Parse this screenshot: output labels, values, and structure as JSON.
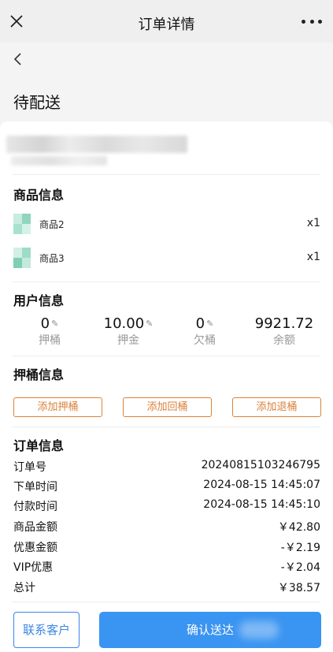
{
  "topbar": {
    "title": "订单详情"
  },
  "status": "待配送",
  "goods": {
    "title": "商品信息",
    "items": [
      {
        "name": "商品2",
        "qty": "x1"
      },
      {
        "name": "商品3",
        "qty": "x1"
      }
    ]
  },
  "user": {
    "title": "用户信息",
    "stats": [
      {
        "value": "0",
        "label": "押桶",
        "editable": true
      },
      {
        "value": "10.00",
        "label": "押金",
        "editable": true
      },
      {
        "value": "0",
        "label": "欠桶",
        "editable": true
      },
      {
        "value": "9921.72",
        "label": "余额",
        "editable": false
      }
    ]
  },
  "bucket": {
    "title": "押桶信息",
    "buttons": [
      "添加押桶",
      "添加回桶",
      "添加退桶"
    ]
  },
  "order": {
    "title": "订单信息",
    "rows": [
      {
        "key": "订单号",
        "value": "20240815103246795"
      },
      {
        "key": "下单时间",
        "value": "2024-08-15 14:45:07"
      },
      {
        "key": "付款时间",
        "value": "2024-08-15 14:45:10"
      },
      {
        "key": "商品金额",
        "value": "￥42.80"
      },
      {
        "key": "优惠金额",
        "value": "-￥2.19"
      },
      {
        "key": "VIP优惠",
        "value": "-￥2.04"
      },
      {
        "key": "总计",
        "value": "￥38.57"
      }
    ]
  },
  "actions": {
    "contact": "联系客户",
    "confirm": "确认送达"
  },
  "colors": {
    "accent_orange": "#d9823b",
    "primary_blue": "#3a94f1",
    "thumb_green": "#9fdcc6"
  },
  "icons": {
    "close": "close-icon",
    "more": "more-icon",
    "back": "chevron-left-icon",
    "edit": "pencil-icon"
  }
}
